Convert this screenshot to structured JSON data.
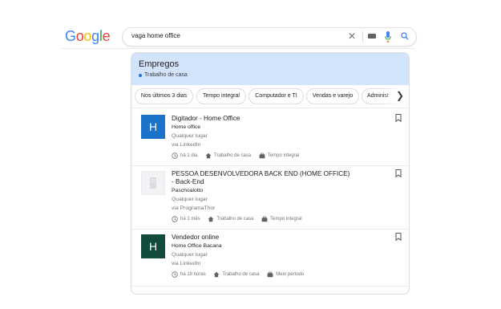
{
  "header": {
    "logo": {
      "letters": [
        "G",
        "o",
        "o",
        "g",
        "l",
        "e"
      ],
      "colors": [
        "#4285f4",
        "#ea4335",
        "#fbbc05",
        "#4285f4",
        "#34a853",
        "#ea4335"
      ]
    },
    "search": {
      "query": "vaga home office"
    }
  },
  "jobs_panel": {
    "title": "Empregos",
    "subtitle": "Trabalho de casa",
    "chips": [
      "Nos últimos 3 dias",
      "Tempo integral",
      "Computador e TI",
      "Vendas e varejo",
      "Administ"
    ],
    "listings": [
      {
        "logo_letter": "H",
        "logo_color": "#1a73c8",
        "title_line1": "Digitador - Home Office",
        "title_line2": "",
        "company": "Home office",
        "location": "Qualquer lugar",
        "via": "via LinkedIn",
        "posted": "há 1 dia",
        "place": "Trabalho de casa",
        "schedule": "Tempo integral"
      },
      {
        "logo_letter": "",
        "logo_color": "#f1f3f4",
        "title_line1": "PESSOA DESENVOLVEDORA BACK END (HOME OFFICE)",
        "title_line2": "- Back-End",
        "company": "Paschoalotto",
        "location": "Qualquer lugar",
        "via": "via ProgramaThor",
        "posted": "há 1 mês",
        "place": "Trabalho de casa",
        "schedule": "Tempo integral"
      },
      {
        "logo_letter": "H",
        "logo_color": "#124a3c",
        "title_line1": "Vendedor online",
        "title_line2": "",
        "company": "Home Office Bacana",
        "location": "Qualquer lugar",
        "via": "via LinkedIn",
        "posted": "há 18 horas",
        "place": "Trabalho de casa",
        "schedule": "Meio período"
      }
    ]
  }
}
